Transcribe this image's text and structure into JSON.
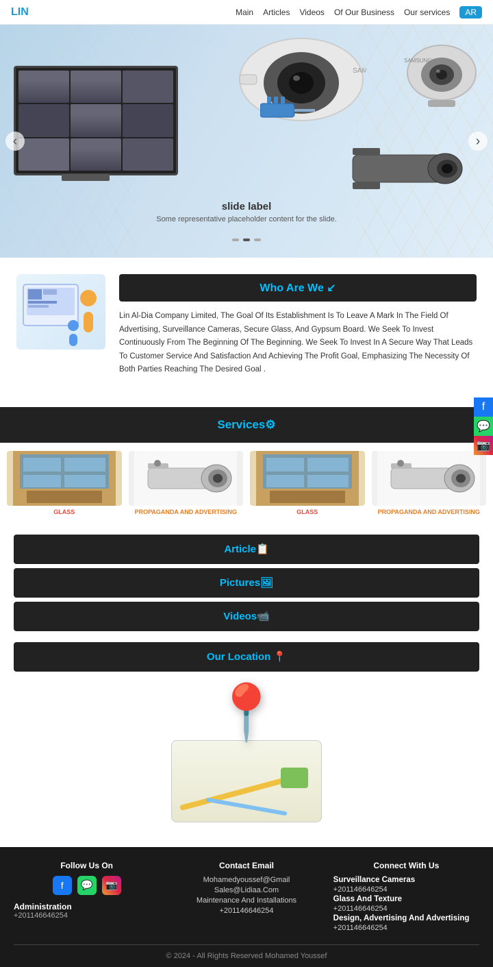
{
  "navbar": {
    "brand": "LIN",
    "links": [
      "Main",
      "Articles",
      "Videos",
      "Of Our Business",
      "Our services"
    ],
    "lang": "AR"
  },
  "hero": {
    "slide_label": "slide label",
    "slide_sub": "Some representative placeholder content for the slide.",
    "prev_icon": "‹",
    "next_icon": "›"
  },
  "who": {
    "title": "Who Are We ↙",
    "text": "Lin Al-Dia Company Limited, The Goal Of Its Establishment Is To Leave A Mark In The Field Of Advertising, Surveillance Cameras, Secure Glass, And Gypsum Board. We Seek To Invest Continuously From The Beginning Of The Beginning. We Seek To Invest In A Secure Way That Leads To Customer Service And Satisfaction And Achieving The Profit Goal, Emphasizing The Necessity Of Both Parties Reaching The Desired Goal ."
  },
  "services": {
    "title": "Services⚙",
    "items": [
      {
        "label": "GLASS",
        "type": "building",
        "color": "red"
      },
      {
        "label": "PROPAGANDA AND ADVERTISING",
        "type": "camera",
        "color": "orange"
      },
      {
        "label": "GLASS",
        "type": "building",
        "color": "red"
      },
      {
        "label": "PROPAGANDA AND ADVERTISING",
        "type": "camera",
        "color": "orange"
      }
    ]
  },
  "sections": {
    "article": "Article📋",
    "pictures": "Pictures🖼",
    "videos": "Videos📹"
  },
  "location": {
    "title": "Our Location 📍"
  },
  "footer": {
    "follow_us": "Follow Us On",
    "contact_email_title": "Contact Email",
    "emails": [
      "Mohamedyoussef@Gmail",
      "Sales@Lidiaa.Com",
      "Maintenance And Installations",
      "+201146646254"
    ],
    "connect_title": "Connect With Us",
    "connect_items": [
      {
        "label": "Surveillance Cameras",
        "bold": true
      },
      {
        "label": "+201146646254",
        "bold": false
      },
      {
        "label": "Glass And Texture",
        "bold": true
      },
      {
        "label": "+201146646254",
        "bold": false
      },
      {
        "label": "Design, Advertising And Advertising",
        "bold": true
      },
      {
        "label": "+201146646254",
        "bold": false
      }
    ],
    "admin_label": "Administration",
    "admin_phone": "+201146646254",
    "copyright": "© 2024 - All Rights Reserved Mohamed Youssef"
  }
}
